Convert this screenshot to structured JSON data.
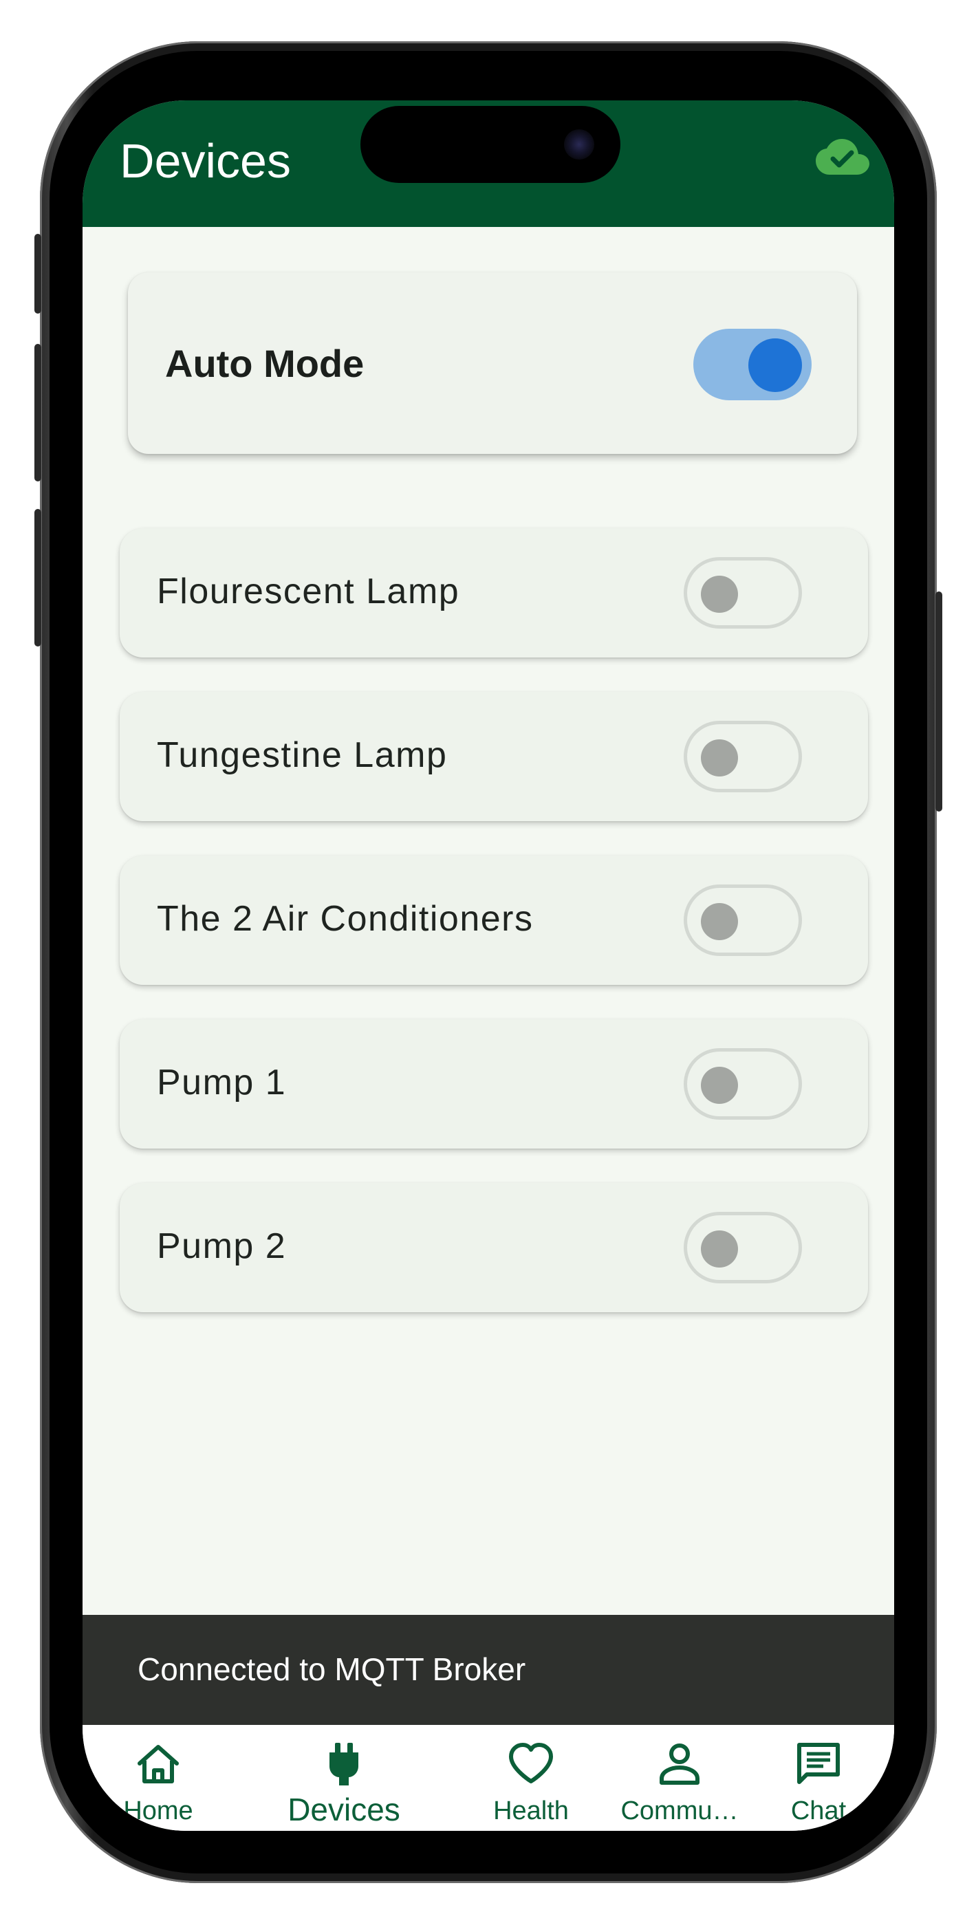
{
  "appbar": {
    "title": "Devices",
    "status_icon": "cloud-done-icon"
  },
  "auto_mode": {
    "label": "Auto Mode",
    "enabled": true
  },
  "devices": [
    {
      "name": "Flourescent Lamp",
      "on": false
    },
    {
      "name": "Tungestine Lamp",
      "on": false
    },
    {
      "name": "The 2 Air Conditioners",
      "on": false
    },
    {
      "name": "Pump 1",
      "on": false
    },
    {
      "name": "Pump 2",
      "on": false
    }
  ],
  "snackbar": {
    "message": "Connected to MQTT Broker"
  },
  "nav": {
    "items": [
      {
        "label": "Home",
        "icon": "home-icon",
        "active": false
      },
      {
        "label": "Devices",
        "icon": "plug-icon",
        "active": true
      },
      {
        "label": "Health",
        "icon": "heart-icon",
        "active": false
      },
      {
        "label": "Commu…",
        "icon": "person-icon",
        "active": false
      },
      {
        "label": "Chat",
        "icon": "chat-icon",
        "active": false
      }
    ]
  },
  "colors": {
    "primary": "#02532e",
    "switch_on_track": "#8ab8e4",
    "switch_on_thumb": "#1e73d6",
    "nav_accent": "#0c5f39",
    "snackbar_bg": "#2e302d",
    "cloud_icon": "#4caf50"
  }
}
